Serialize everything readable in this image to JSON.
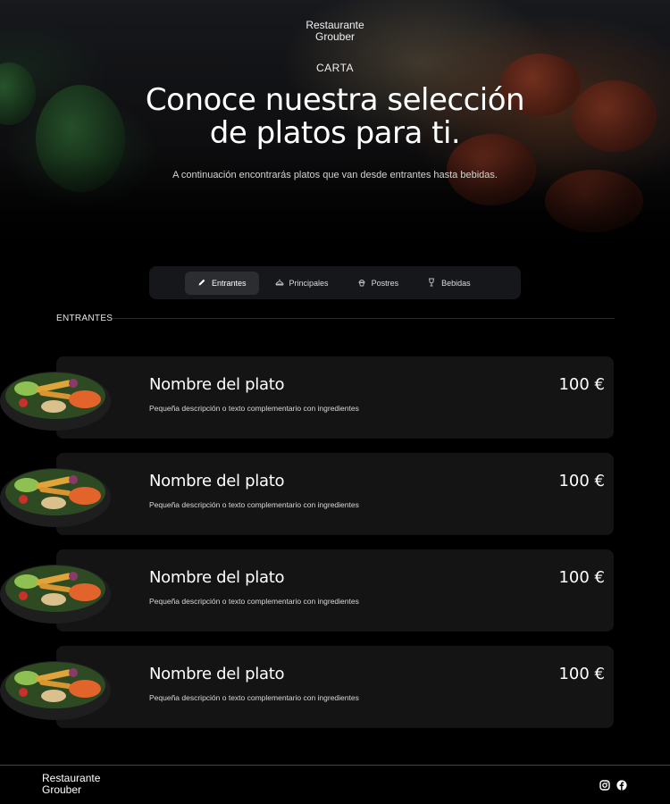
{
  "brand": {
    "line1": "Restaurante",
    "line2": "Grouber"
  },
  "hero": {
    "eyebrow": "CARTA",
    "title_line1": "Conoce nuestra selección",
    "title_line2": "de platos para ti.",
    "subtitle": "A continuación encontrarás platos que van desde entrantes hasta bebidas."
  },
  "tabs": [
    {
      "label": "Entrantes",
      "icon": "pencil-icon",
      "active": true
    },
    {
      "label": "Principales",
      "icon": "dish-icon",
      "active": false
    },
    {
      "label": "Postres",
      "icon": "cupcake-icon",
      "active": false
    },
    {
      "label": "Bebidas",
      "icon": "drink-icon",
      "active": false
    }
  ],
  "section": {
    "label": "ENTRANTES"
  },
  "dishes": [
    {
      "name": "Nombre del plato",
      "description": "Pequeña descripción o texto complementario con ingredientes",
      "price": "100 €"
    },
    {
      "name": "Nombre del plato",
      "description": "Pequeña descripción o texto complementario con ingredientes",
      "price": "100 €"
    },
    {
      "name": "Nombre del plato",
      "description": "Pequeña descripción o texto complementario con ingredientes",
      "price": "100 €"
    },
    {
      "name": "Nombre del plato",
      "description": "Pequeña descripción o texto complementario con ingredientes",
      "price": "100 €"
    }
  ],
  "footer": {
    "brand_line1": "Restaurante",
    "brand_line2": "Grouber",
    "social": [
      "instagram-icon",
      "facebook-icon"
    ]
  },
  "colors": {
    "background": "#000000",
    "card": "#141414",
    "tab_active": "#2b2d31"
  }
}
